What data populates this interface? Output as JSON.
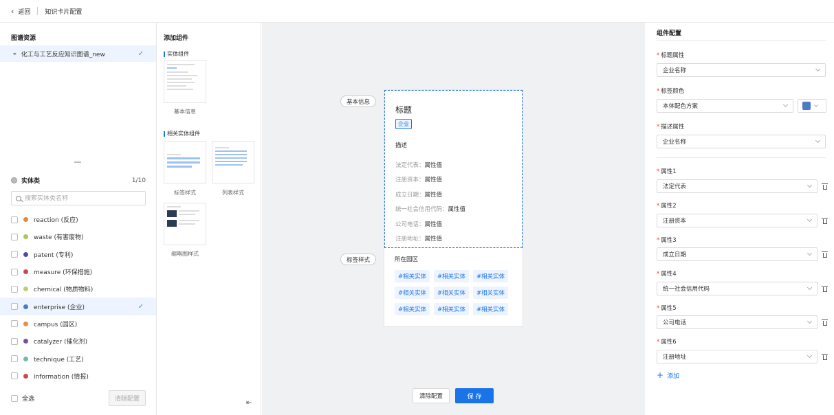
{
  "topbar": {
    "back_label": "返回",
    "page_title": "知识卡片配置"
  },
  "left": {
    "graph_section_title": "图谱资源",
    "graph_item": "化工与工艺反应知识图谱_new",
    "entity_section_title": "实体类",
    "entity_count": "1/10",
    "search_placeholder": "搜索实体类名称",
    "entities": [
      {
        "label": "reaction (反应)",
        "color": "#e08a3c"
      },
      {
        "label": "waste (有害废物)",
        "color": "#a6c95a"
      },
      {
        "label": "patent (专利)",
        "color": "#4b4f9e"
      },
      {
        "label": "measure (环保措施)",
        "color": "#d0464e"
      },
      {
        "label": "chemical (物质物料)",
        "color": "#b7cf7a"
      },
      {
        "label": "enterprise (企业)",
        "color": "#4d79c7"
      },
      {
        "label": "campus (园区)",
        "color": "#e0934a"
      },
      {
        "label": "catalyzer (催化剂)",
        "color": "#7a4f9e"
      },
      {
        "label": "technique (工艺)",
        "color": "#6cbf9a"
      },
      {
        "label": "information (情报)",
        "color": "#d0464e"
      }
    ],
    "select_all_label": "全选",
    "clear_config_label": "清除配置"
  },
  "components": {
    "title": "添加组件",
    "entity_group": "实体组件",
    "related_group": "相关实体组件",
    "basic_info_caption": "基本信息",
    "tag_style_caption": "标签样式",
    "list_style_caption": "列表样式",
    "thumbnail_style_caption": "缩略图样式"
  },
  "canvas": {
    "basic_pill": "基本信息",
    "tag_pill": "标签样式",
    "card_title": "标题",
    "card_tag": "企业",
    "card_desc": "描述",
    "attrs": [
      {
        "key": "法定代表：",
        "value": "属性值"
      },
      {
        "key": "注册资本：",
        "value": "属性值"
      },
      {
        "key": "成立日期：",
        "value": "属性值"
      },
      {
        "key": "统一社会信用代码：",
        "value": "属性值"
      },
      {
        "key": "公司电话：",
        "value": "属性值"
      },
      {
        "key": "注册地址：",
        "value": "属性值"
      }
    ],
    "related_title": "所在园区",
    "related_tag": "#相关实体",
    "clear_btn": "清除配置",
    "save_btn": "保 存"
  },
  "config": {
    "title": "组件配置",
    "title_attr_label": "标题属性",
    "title_attr_value": "企业名称",
    "tag_color_label": "标签颜色",
    "tag_color_value": "本体配色方案",
    "tag_color_swatch": "#4d79c7",
    "desc_attr_label": "描述属性",
    "desc_attr_value": "企业名称",
    "attrs": [
      {
        "label": "属性1",
        "value": "法定代表"
      },
      {
        "label": "属性2",
        "value": "注册资本"
      },
      {
        "label": "属性3",
        "value": "成立日期"
      },
      {
        "label": "属性4",
        "value": "统一社会信用代码"
      },
      {
        "label": "属性5",
        "value": "公司电话"
      },
      {
        "label": "属性6",
        "value": "注册地址"
      }
    ],
    "add_label": "添加"
  }
}
